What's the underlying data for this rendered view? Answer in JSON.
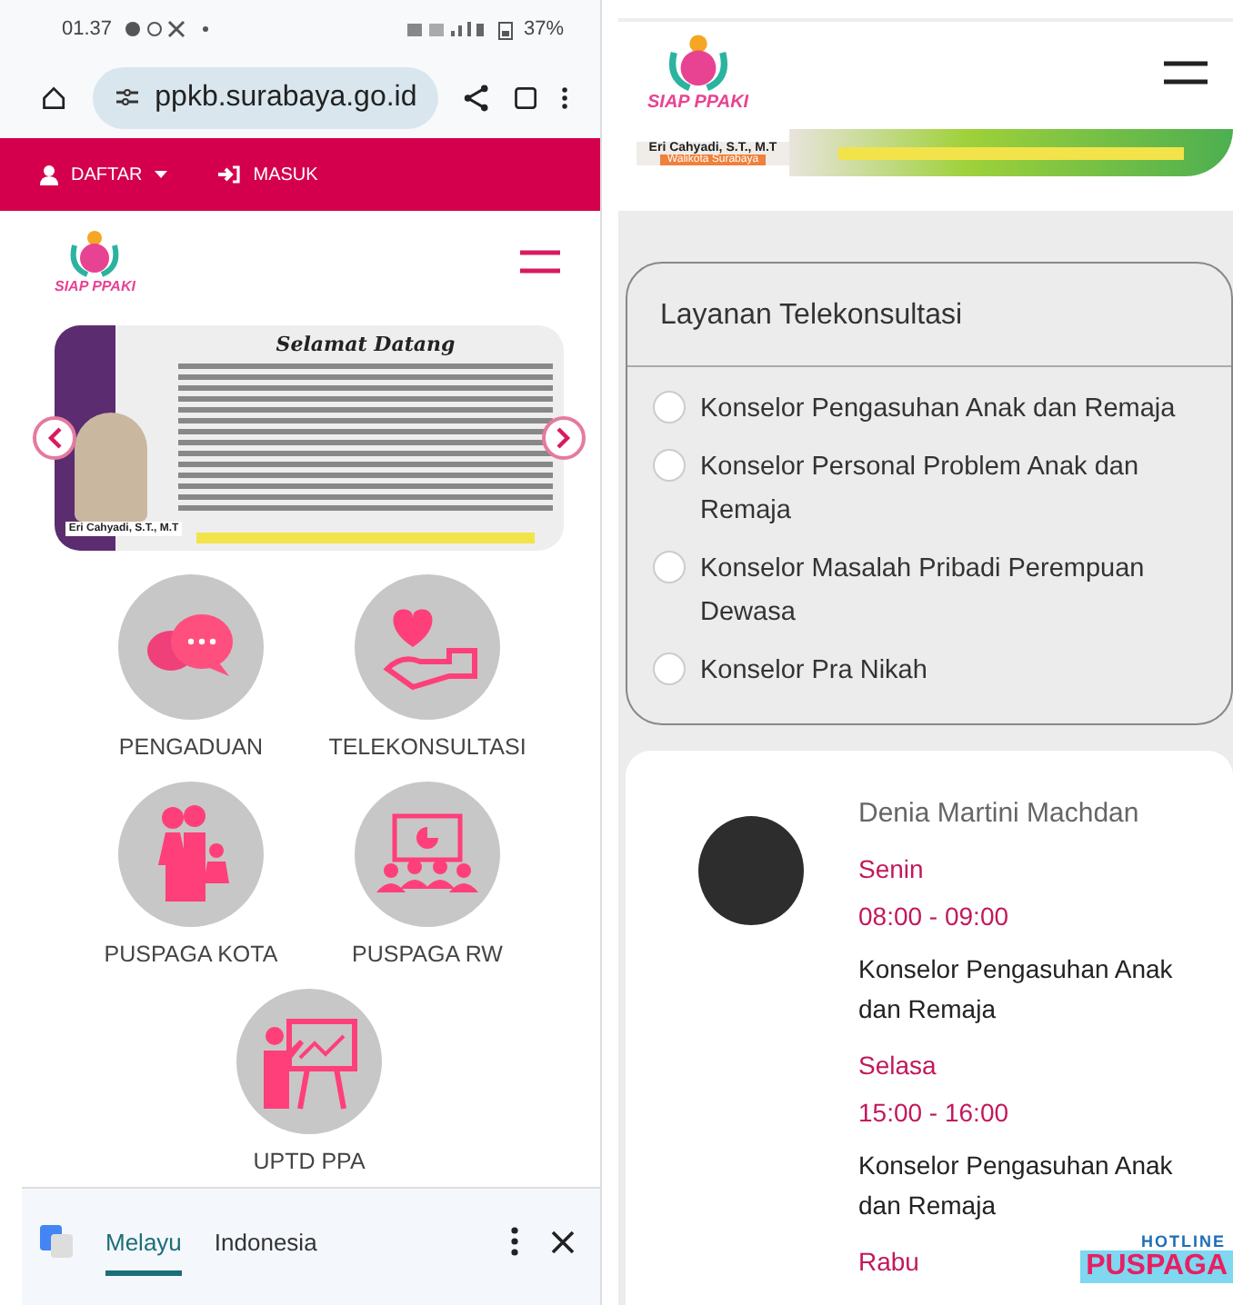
{
  "status_bar": {
    "time": "01.37",
    "battery": "37%"
  },
  "browser": {
    "url": "ppkb.surabaya.go.id"
  },
  "left_page": {
    "nav": [
      {
        "label": "DAFTAR",
        "kind": "dropdown"
      },
      {
        "label": "MASUK",
        "kind": "login"
      }
    ],
    "logo": {
      "text": "SIAP PPAKI"
    },
    "banner": {
      "title": "Selamat Datang",
      "caption": "Eri Cahyadi, S.T., M.T"
    },
    "tiles": [
      {
        "label": "PENGADUAN",
        "kind": "chat"
      },
      {
        "label": "TELEKONSULTASI",
        "kind": "heart"
      },
      {
        "label": "PUSPAGA KOTA",
        "kind": "family"
      },
      {
        "label": "PUSPAGA RW",
        "kind": "audience"
      },
      {
        "label": "UPTD PPA",
        "kind": "teacher"
      }
    ],
    "translate_bar": {
      "languages": [
        {
          "label": "Melayu",
          "selected": true
        },
        {
          "label": "Indonesia",
          "selected": false
        }
      ]
    }
  },
  "right_page": {
    "logo": {
      "text": "SIAP PPAKI"
    },
    "banner": {
      "caption": "Eri Cahyadi, S.T., M.T",
      "subcaption": "Walikota Surabaya"
    },
    "service_panel": {
      "title": "Layanan Telekonsultasi",
      "options": [
        {
          "label": "Konselor Pengasuhan Anak dan Remaja",
          "checked": false
        },
        {
          "label": "Konselor Personal Problem Anak dan Remaja",
          "checked": false
        },
        {
          "label": "Konselor Masalah Pribadi Perempuan Dewasa",
          "checked": false
        },
        {
          "label": "Konselor Pra Nikah",
          "checked": false
        }
      ]
    },
    "counselor": {
      "name": "Denia Martini Machdan",
      "schedule": [
        {
          "day": "Senin",
          "time": "08:00 - 09:00",
          "service": "Konselor Pengasuhan Anak dan Remaja"
        },
        {
          "day": "Selasa",
          "time": "15:00 - 16:00",
          "service": "Konselor Pengasuhan Anak dan Remaja"
        },
        {
          "day": "Rabu"
        }
      ]
    },
    "hotline_badge": {
      "line1": "HOTLINE",
      "line2": "PUSPAGA"
    }
  }
}
